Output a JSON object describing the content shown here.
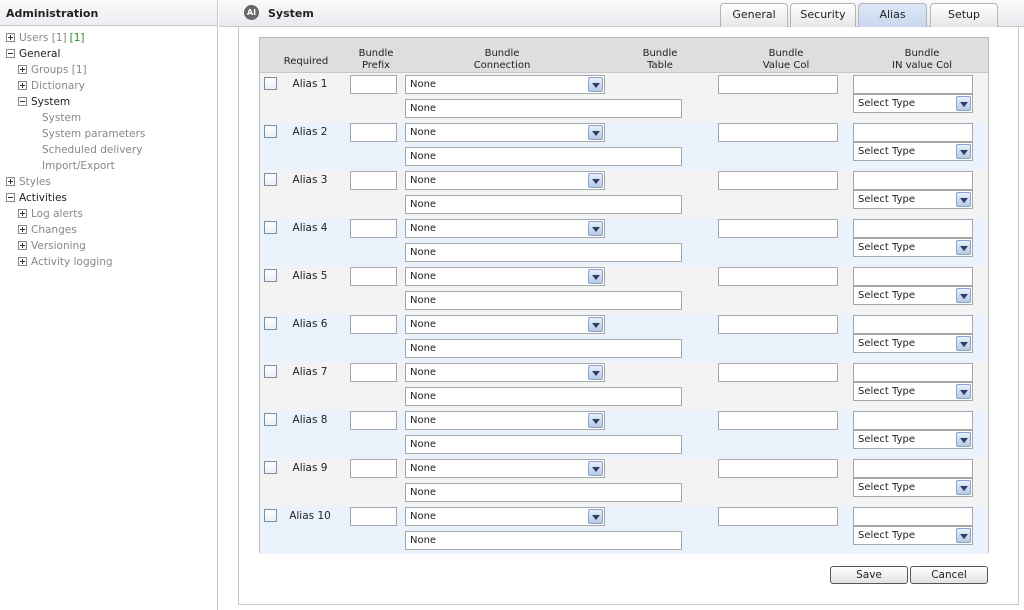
{
  "sidebar": {
    "title": "Administration",
    "items": [
      {
        "label": "Users [1]",
        "extra": "[1]",
        "box": "plus",
        "muted": true,
        "depth": 0
      },
      {
        "label": "General",
        "box": "minus",
        "muted": false,
        "depth": 0
      },
      {
        "label": "Groups [1]",
        "box": "plus",
        "muted": true,
        "depth": 1
      },
      {
        "label": "Dictionary",
        "box": "plus",
        "muted": true,
        "depth": 1
      },
      {
        "label": "System",
        "box": "minus",
        "muted": false,
        "depth": 1
      },
      {
        "label": "System",
        "box": "",
        "muted": true,
        "depth": 2
      },
      {
        "label": "System parameters",
        "box": "",
        "muted": true,
        "depth": 2
      },
      {
        "label": "Scheduled delivery",
        "box": "",
        "muted": true,
        "depth": 2
      },
      {
        "label": "Import/Export",
        "box": "",
        "muted": true,
        "depth": 2
      },
      {
        "label": "Styles",
        "box": "plus",
        "muted": true,
        "depth": 0
      },
      {
        "label": "Activities",
        "box": "minus",
        "muted": false,
        "depth": 0
      },
      {
        "label": "Log alerts",
        "box": "plus",
        "muted": true,
        "depth": 1
      },
      {
        "label": "Changes",
        "box": "plus",
        "muted": true,
        "depth": 1
      },
      {
        "label": "Versioning",
        "box": "plus",
        "muted": true,
        "depth": 1
      },
      {
        "label": "Activity logging",
        "box": "plus",
        "muted": true,
        "depth": 1
      }
    ]
  },
  "header": {
    "logo_text": "AI",
    "title": "System",
    "tabs": [
      "General",
      "Security",
      "Alias",
      "Setup"
    ],
    "active_tab": "Alias"
  },
  "grid": {
    "columns": {
      "required": "Required",
      "prefix": [
        "Bundle",
        "Prefix"
      ],
      "connection": [
        "Bundle",
        "Connection"
      ],
      "table": [
        "Bundle",
        "Table"
      ],
      "value_col": [
        "Bundle",
        "Value Col"
      ],
      "in_value_col": [
        "Bundle",
        "IN value Col"
      ]
    },
    "rows": [
      {
        "label": "Alias 1",
        "connection": "None",
        "table": "None",
        "type": "Select Type"
      },
      {
        "label": "Alias 2",
        "connection": "None",
        "table": "None",
        "type": "Select Type"
      },
      {
        "label": "Alias 3",
        "connection": "None",
        "table": "None",
        "type": "Select Type"
      },
      {
        "label": "Alias 4",
        "connection": "None",
        "table": "None",
        "type": "Select Type"
      },
      {
        "label": "Alias 5",
        "connection": "None",
        "table": "None",
        "type": "Select Type"
      },
      {
        "label": "Alias 6",
        "connection": "None",
        "table": "None",
        "type": "Select Type"
      },
      {
        "label": "Alias 7",
        "connection": "None",
        "table": "None",
        "type": "Select Type"
      },
      {
        "label": "Alias 8",
        "connection": "None",
        "table": "None",
        "type": "Select Type"
      },
      {
        "label": "Alias 9",
        "connection": "None",
        "table": "None",
        "type": "Select Type"
      },
      {
        "label": "Alias 10",
        "connection": "None",
        "table": "None",
        "type": "Select Type"
      }
    ]
  },
  "footer": {
    "save_label": "Save",
    "cancel_label": "Cancel"
  }
}
